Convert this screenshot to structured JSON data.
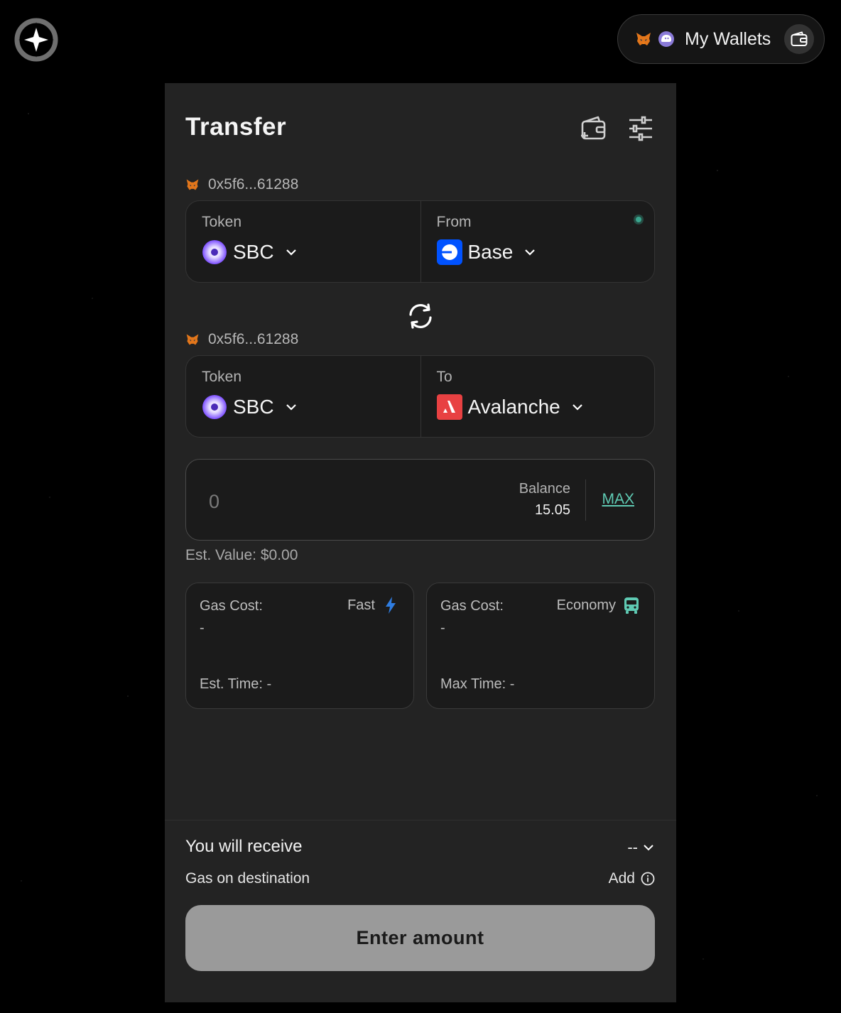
{
  "header": {
    "logo_icon": "star-compass-logo-icon",
    "wallets_label": "My Wallets"
  },
  "transfer": {
    "title": "Transfer",
    "source": {
      "address": "0x5f6...61288",
      "token_label": "Token",
      "token": "SBC",
      "chain_label": "From",
      "chain": "Base"
    },
    "destination": {
      "address": "0x5f6...61288",
      "token_label": "Token",
      "token": "SBC",
      "chain_label": "To",
      "chain": "Avalanche"
    },
    "amount": {
      "placeholder": "0",
      "value": "",
      "balance_label": "Balance",
      "balance_value": "15.05",
      "max_label": "MAX"
    },
    "est_value": "Est. Value: $0.00",
    "gas_options": [
      {
        "label": "Gas Cost:",
        "value": "-",
        "speed": "Fast",
        "time": "Est. Time: -",
        "icon": "lightning-icon"
      },
      {
        "label": "Gas Cost:",
        "value": "-",
        "speed": "Economy",
        "time": "Max Time: -",
        "icon": "bus-icon"
      }
    ],
    "receive_label": "You will receive",
    "receive_value": "--",
    "gas_destination_label": "Gas on destination",
    "gas_destination_action": "Add",
    "cta_label": "Enter amount"
  },
  "colors": {
    "accent_teal": "#5fcab3",
    "panel_bg": "#232323",
    "cta_bg": "#9a9a9a",
    "base_blue": "#0052ff",
    "avalanche_red": "#e84142",
    "fast_blue": "#2f7de1"
  }
}
